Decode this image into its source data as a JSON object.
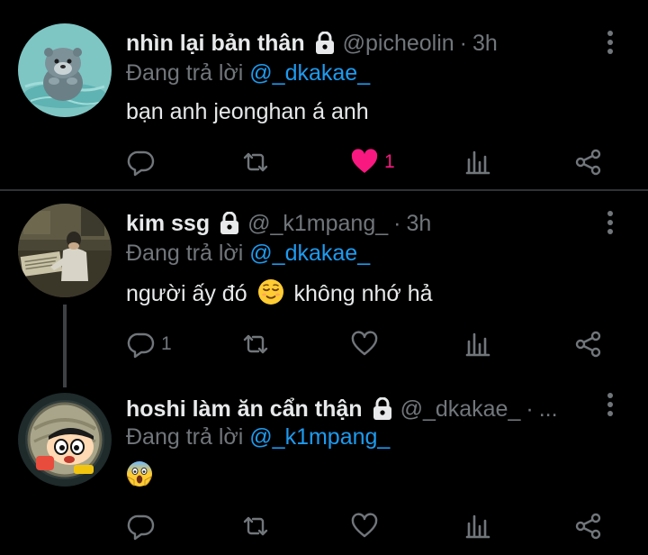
{
  "colors": {
    "background": "#000000",
    "text": "#e7e9ea",
    "muted": "#71767b",
    "link": "#1d9bf0",
    "like": "#f91880",
    "divider": "#2f3336"
  },
  "reply_prefix": "Đang trả lời",
  "tweets": [
    {
      "display_name": "nhìn lại bản thân",
      "handle": "@picheolin",
      "time": "3h",
      "reply_to": "@_dkakae_",
      "text": "bạn anh jeonghan á anh",
      "reply_count": "",
      "like_count": "1",
      "liked": true
    },
    {
      "display_name": "kim ssg",
      "handle": "@_k1mpang_",
      "time": "3h",
      "reply_to": "@_dkakae_",
      "text_before": "người ấy đó",
      "text_after": "không nhớ hả",
      "emoji": "relieved-face",
      "reply_count": "1",
      "like_count": "",
      "liked": false
    },
    {
      "display_name": "hoshi làm ăn cẩn thận",
      "handle": "@_dkakae_",
      "time": "...",
      "reply_to": "@_k1mpang_",
      "emoji": "face-screaming-in-fear",
      "reply_count": "",
      "like_count": "",
      "liked": false
    }
  ],
  "icons": [
    "lock-icon",
    "more-icon",
    "reply-icon",
    "retweet-icon",
    "like-icon",
    "views-icon",
    "share-icon"
  ]
}
